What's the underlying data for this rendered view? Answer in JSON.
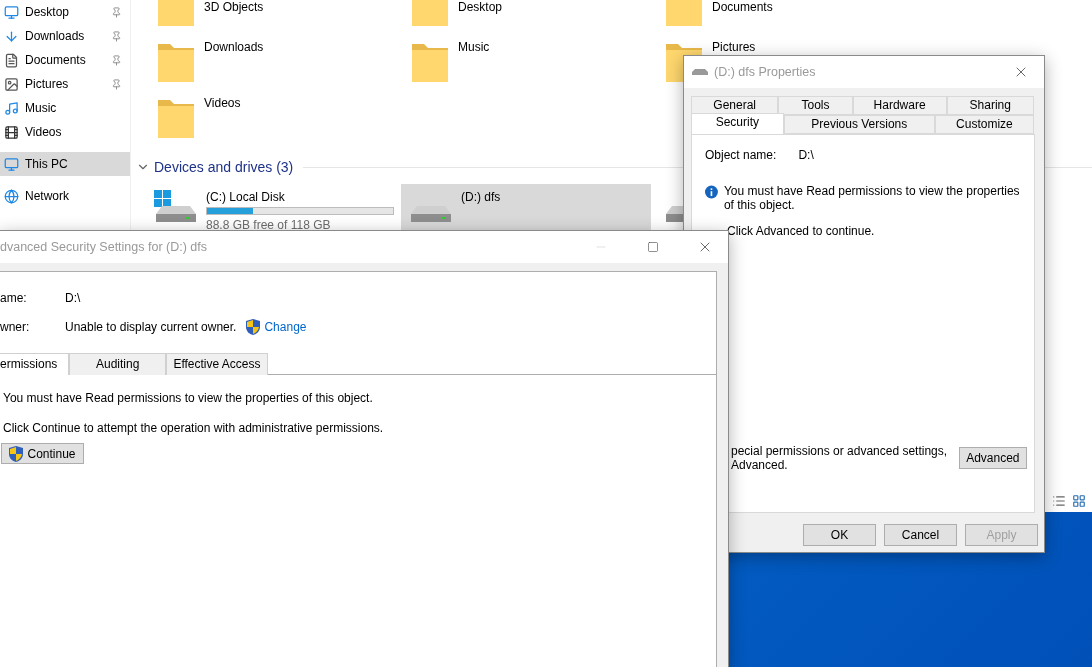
{
  "explorer": {
    "sidebar": {
      "items": [
        {
          "label": "Desktop",
          "pinned": true,
          "selected": false
        },
        {
          "label": "Downloads",
          "pinned": true,
          "selected": false
        },
        {
          "label": "Documents",
          "pinned": true,
          "selected": false
        },
        {
          "label": "Pictures",
          "pinned": true,
          "selected": false
        },
        {
          "label": "Music",
          "pinned": false,
          "selected": false
        },
        {
          "label": "Videos",
          "pinned": false,
          "selected": false
        },
        {
          "label": "This PC",
          "pinned": false,
          "selected": true
        },
        {
          "label": "Network",
          "pinned": false,
          "selected": false
        }
      ]
    },
    "folders": [
      {
        "label": "3D Objects"
      },
      {
        "label": "Desktop"
      },
      {
        "label": "Documents"
      },
      {
        "label": "Downloads"
      },
      {
        "label": "Music"
      },
      {
        "label": "Pictures"
      },
      {
        "label": "Videos"
      }
    ],
    "drives_section": {
      "title": "Devices and drives (3)"
    },
    "drives": [
      {
        "label": "(C:) Local Disk",
        "system": true,
        "level": 0.247,
        "free_text": "88.8 GB free of 118 GB",
        "selected": false
      },
      {
        "label": "(D:) dfs",
        "system": false,
        "selected": true
      },
      {
        "system": false,
        "selected": false
      }
    ]
  },
  "properties_window": {
    "title": "(D:) dfs Properties",
    "tab_rows": [
      [
        {
          "label": "General",
          "selected": false
        },
        {
          "label": "Tools",
          "selected": false
        },
        {
          "label": "Hardware",
          "selected": false
        },
        {
          "label": "Sharing",
          "selected": false
        }
      ],
      [
        {
          "label": "Security",
          "selected": true
        },
        {
          "label": "Previous Versions",
          "selected": false
        },
        {
          "label": "Customize",
          "selected": false
        }
      ]
    ],
    "object_name_label": "Object name:",
    "object_name": "D:\\",
    "info_message": "You must have Read permissions to view the properties of this object.",
    "instruction": "Click Advanced to continue.",
    "advanced_hint": [
      "pecial permissions or advanced settings,",
      "Advanced."
    ],
    "advanced_button": "Advanced",
    "buttons": [
      {
        "label": "OK",
        "disabled": false
      },
      {
        "label": "Cancel",
        "disabled": false
      },
      {
        "label": "Apply",
        "disabled": true
      }
    ]
  },
  "advanced_window": {
    "title": "dvanced Security Settings for (D:) dfs",
    "fields": [
      {
        "label": "ame:",
        "value": "D:\\"
      },
      {
        "label": "wner:",
        "value": "Unable to display current owner.",
        "link": "Change"
      }
    ],
    "tabs": [
      {
        "label": "ermissions",
        "selected": true
      },
      {
        "label": "Auditing",
        "selected": false
      },
      {
        "label": "Effective Access",
        "selected": false
      }
    ],
    "messages": [
      "You must have Read permissions to view the properties of this object.",
      "Click Continue to attempt the operation with administrative permissions."
    ],
    "continue_button": "Continue"
  }
}
